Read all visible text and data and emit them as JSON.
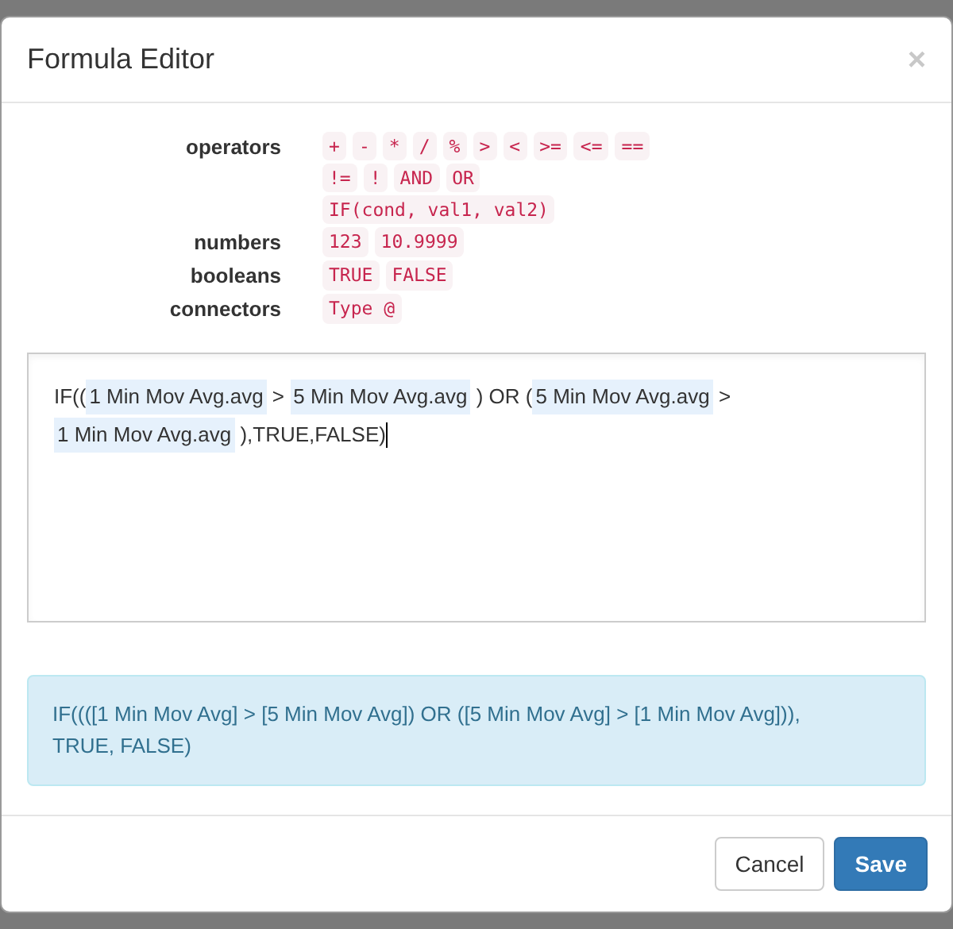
{
  "dialog": {
    "title": "Formula Editor",
    "close": "×"
  },
  "syntax": [
    {
      "label": "operators",
      "codes": [
        "+",
        "-",
        "*",
        "/",
        "%",
        ">",
        "<",
        ">=",
        "<=",
        "==",
        "!=",
        "!",
        "AND",
        "OR",
        "IF(cond, val1, val2)"
      ]
    },
    {
      "label": "numbers",
      "codes": [
        "123",
        "10.9999"
      ]
    },
    {
      "label": "booleans",
      "codes": [
        "TRUE",
        "FALSE"
      ]
    },
    {
      "label": "connectors",
      "codes": [
        "Type @"
      ]
    }
  ],
  "editor": {
    "lines": [
      [
        {
          "kind": "text",
          "text": "IF(("
        },
        {
          "kind": "token",
          "text": "1 Min Mov Avg.avg"
        },
        {
          "kind": "text",
          "text": " > "
        },
        {
          "kind": "token",
          "text": "5 Min Mov Avg.avg"
        },
        {
          "kind": "text",
          "text": " ) OR ("
        },
        {
          "kind": "token",
          "text": "5 Min Mov Avg.avg"
        },
        {
          "kind": "text",
          "text": " >"
        }
      ],
      [
        {
          "kind": "token",
          "text": "1 Min Mov Avg.avg"
        },
        {
          "kind": "text",
          "text": " ),TRUE,FALSE)"
        }
      ]
    ]
  },
  "preview": "IF((([1 Min Mov Avg] > [5 Min Mov Avg]) OR ([5 Min Mov Avg] > [1 Min Mov Avg])), TRUE, FALSE)",
  "buttons": [
    {
      "label": "Cancel",
      "kind": "default"
    },
    {
      "label": "Save",
      "kind": "primary"
    }
  ]
}
